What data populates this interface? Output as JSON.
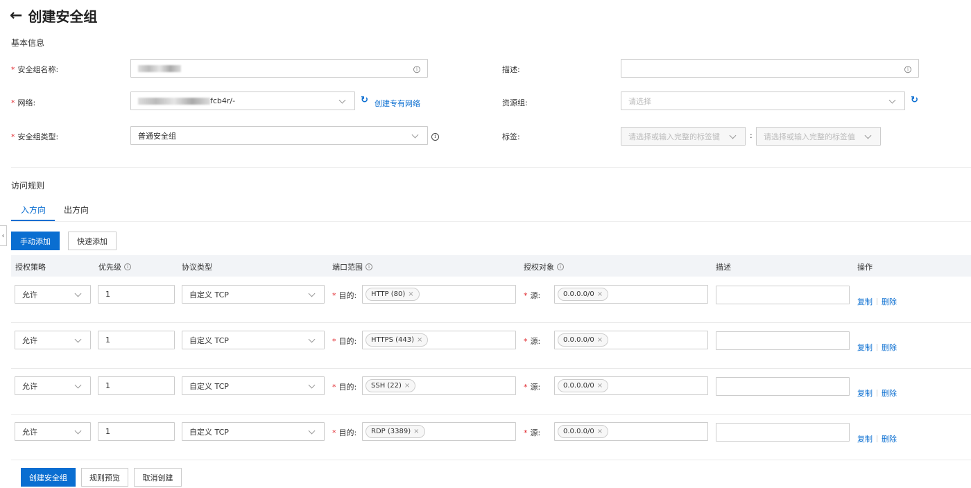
{
  "header": {
    "title": "创建安全组"
  },
  "basic": {
    "section_title": "基本信息",
    "name_label": "安全组名称:",
    "network_label": "网络:",
    "network_value_suffix": "fcb4r/-",
    "create_vpc_link": "创建专有网络",
    "type_label": "安全组类型:",
    "type_value": "普通安全组",
    "desc_label": "描述:",
    "resource_group_label": "资源组:",
    "resource_group_placeholder": "请选择",
    "tags_label": "标签:",
    "tag_key_placeholder": "请选择或输入完整的标签键",
    "tag_value_placeholder": "请选择或输入完整的标签值",
    "tag_colon": ":"
  },
  "rules": {
    "section_title": "访问规则",
    "tabs": [
      {
        "label": "入方向",
        "active": true
      },
      {
        "label": "出方向",
        "active": false
      }
    ],
    "manual_add": "手动添加",
    "quick_add": "快速添加",
    "columns": [
      "授权策略",
      "优先级",
      "协议类型",
      "端口范围",
      "授权对象",
      "描述",
      "操作"
    ],
    "dest_label": "目的:",
    "src_label": "源:",
    "copy_label": "复制",
    "delete_label": "删除",
    "rows": [
      {
        "policy": "允许",
        "priority": "1",
        "protocol": "自定义 TCP",
        "port": "HTTP (80)",
        "source": "0.0.0.0/0"
      },
      {
        "policy": "允许",
        "priority": "1",
        "protocol": "自定义 TCP",
        "port": "HTTPS (443)",
        "source": "0.0.0.0/0"
      },
      {
        "policy": "允许",
        "priority": "1",
        "protocol": "自定义 TCP",
        "port": "SSH (22)",
        "source": "0.0.0.0/0"
      },
      {
        "policy": "允许",
        "priority": "1",
        "protocol": "自定义 TCP",
        "port": "RDP (3389)",
        "source": "0.0.0.0/0"
      }
    ]
  },
  "footer": {
    "create": "创建安全组",
    "preview": "规则预览",
    "cancel": "取消创建"
  },
  "colors": {
    "primary": "#0a6ed1",
    "required": "#e0282e"
  }
}
